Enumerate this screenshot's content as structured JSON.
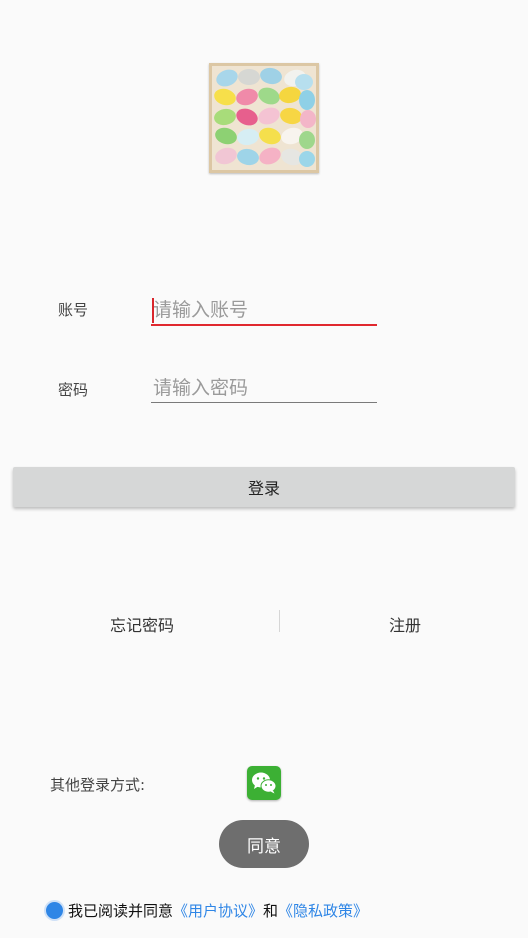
{
  "login": {
    "account_label": "账号",
    "account_placeholder": "请输入账号",
    "password_label": "密码",
    "password_placeholder": "请输入密码",
    "login_button": "登录"
  },
  "links": {
    "forgot_password": "忘记密码",
    "register": "注册"
  },
  "other_login": {
    "label": "其他登录方式:",
    "wechat_icon": "wechat-icon"
  },
  "toast": {
    "text": "同意"
  },
  "agreement": {
    "prefix": "我已阅读并同意",
    "user_agreement": "《用户协议》",
    "conjunction": "和",
    "privacy_policy": "《隐私政策》",
    "checked": true
  },
  "colors": {
    "accent": "#2f86e6",
    "input_focus": "#e0282e",
    "wechat_green": "#3cb034"
  }
}
